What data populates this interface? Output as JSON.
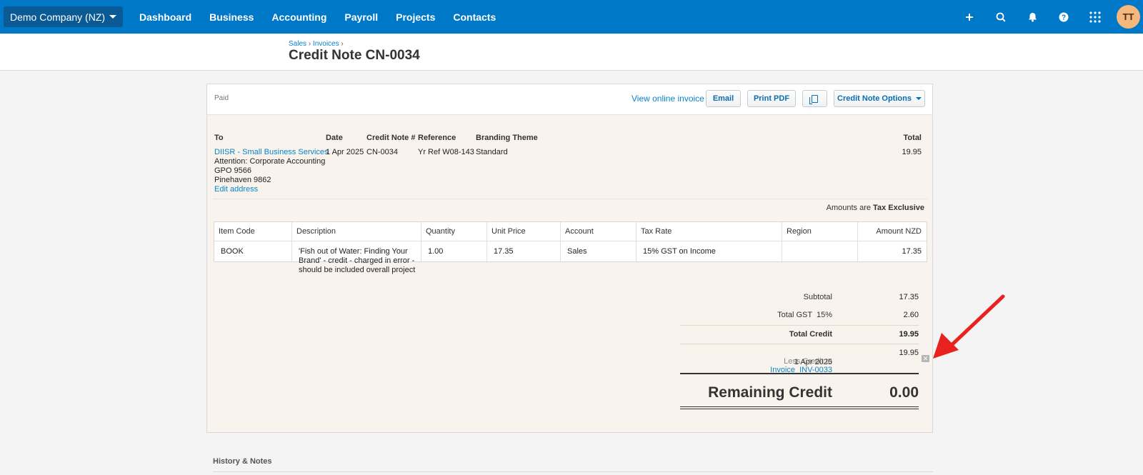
{
  "nav": {
    "org": "Demo Company (NZ)",
    "items": [
      "Dashboard",
      "Business",
      "Accounting",
      "Payroll",
      "Projects",
      "Contacts"
    ],
    "icons": [
      "plus-icon",
      "search-icon",
      "bell-icon",
      "help-icon",
      "apps-icon"
    ],
    "avatar": "TT"
  },
  "header": {
    "crumb_sales": "Sales",
    "crumb_invoices": "Invoices",
    "crumb_sep": "›",
    "title": "Credit Note CN-0034"
  },
  "toolbar": {
    "status": "Paid",
    "view_online": "View online invoice",
    "email": "Email",
    "print_pdf": "Print PDF",
    "options": "Credit Note Options"
  },
  "details": {
    "labels": {
      "to": "To",
      "date": "Date",
      "number": "Credit Note #",
      "reference": "Reference",
      "branding": "Branding Theme",
      "total": "Total"
    },
    "contact": "DIISR - Small Business Services",
    "address": [
      "Attention: Corporate Accounting",
      "GPO 9566",
      "Pinehaven 9862"
    ],
    "edit_address": "Edit address",
    "date": "1 Apr 2025",
    "number": "CN-0034",
    "reference": "Yr Ref W08-143",
    "branding": "Standard",
    "total": "19.95"
  },
  "tax_note": {
    "prefix": "Amounts are",
    "mode": "Tax Exclusive"
  },
  "table": {
    "headers": [
      "Item Code",
      "Description",
      "Quantity",
      "Unit Price",
      "Account",
      "Tax Rate",
      "Region",
      "Amount NZD"
    ],
    "rows": [
      {
        "item_code": "BOOK",
        "description": [
          "'Fish out of Water: Finding Your",
          "Brand' - credit - charged in error -",
          "should be included overall project"
        ],
        "quantity": "1.00",
        "unit_price": "17.35",
        "account": "Sales",
        "tax_rate": "15% GST on Income",
        "region": "",
        "amount": "17.35"
      }
    ]
  },
  "totals": {
    "subtotal_label": "Subtotal",
    "subtotal": "17.35",
    "gst_label": "Total GST  15%",
    "gst": "2.60",
    "total_credit_label": "Total Credit",
    "total_credit": "19.95",
    "less_credit_prefix": "Less Credit to",
    "less_credit_link": "Invoice  INV-0033",
    "less_credit_date": "1 Apr 2025",
    "less_credit_amount": "19.95",
    "remove_glyph": "✕",
    "remaining_label": "Remaining Credit",
    "remaining": "0.00"
  },
  "history": {
    "title": "History & Notes"
  },
  "annotation": {
    "arrow_color": "#e8231f"
  }
}
